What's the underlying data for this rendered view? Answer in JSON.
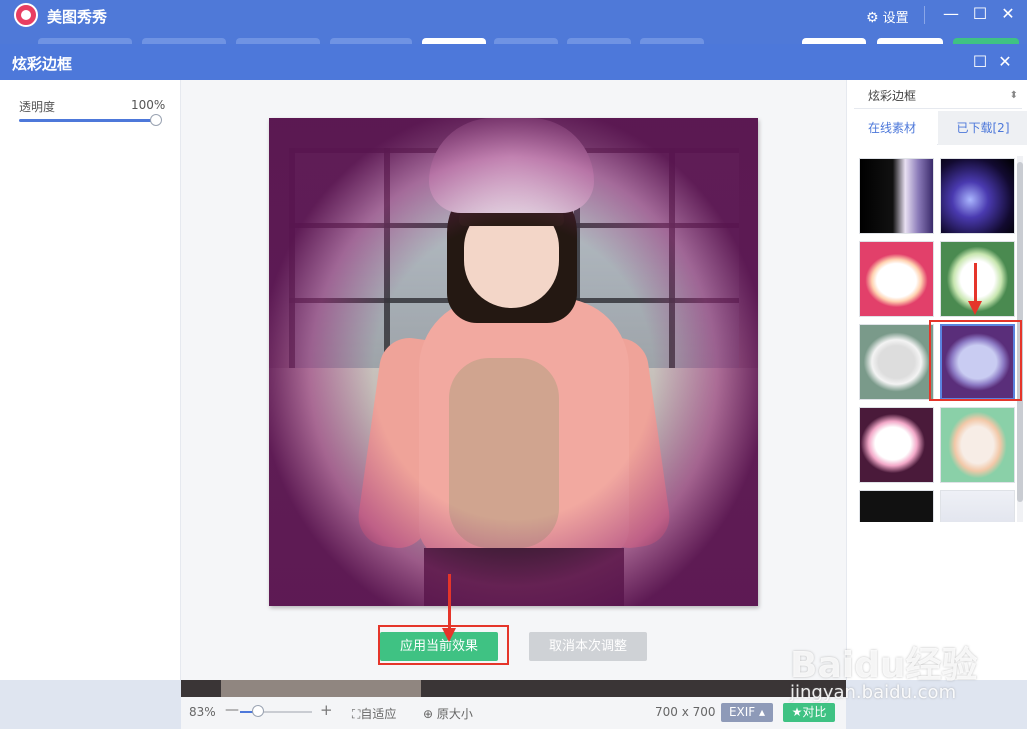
{
  "app": {
    "title": "美图秀秀",
    "settings_label": "设置",
    "minimize": "—",
    "maximize": "☐",
    "close": "✕"
  },
  "dialog": {
    "title": "炫彩边框",
    "maximize": "☐",
    "close": "✕"
  },
  "left_panel": {
    "opacity_label": "透明度",
    "opacity_value": "100%",
    "opacity_level": 1.0
  },
  "canvas": {
    "apply_label": "应用当前效果",
    "cancel_label": "取消本次调整"
  },
  "right_panel": {
    "category": "炫彩边框",
    "tabs": [
      {
        "label": "在线素材"
      },
      {
        "label": "已下载[2]"
      }
    ]
  },
  "status": {
    "zoom": "83%",
    "zoom_minus": "—",
    "zoom_plus": "+",
    "fit_label": "自适应",
    "original_label": "原大小",
    "dimensions": "700 x 700",
    "exif_label": "EXIF ▴",
    "compare_label": "对比"
  },
  "watermark": {
    "line1": "Baidu经验",
    "line2": "jingyan.baidu.com"
  },
  "colors": {
    "accent": "#4d78da",
    "apply": "#3fc283",
    "highlight": "#e5352a"
  }
}
